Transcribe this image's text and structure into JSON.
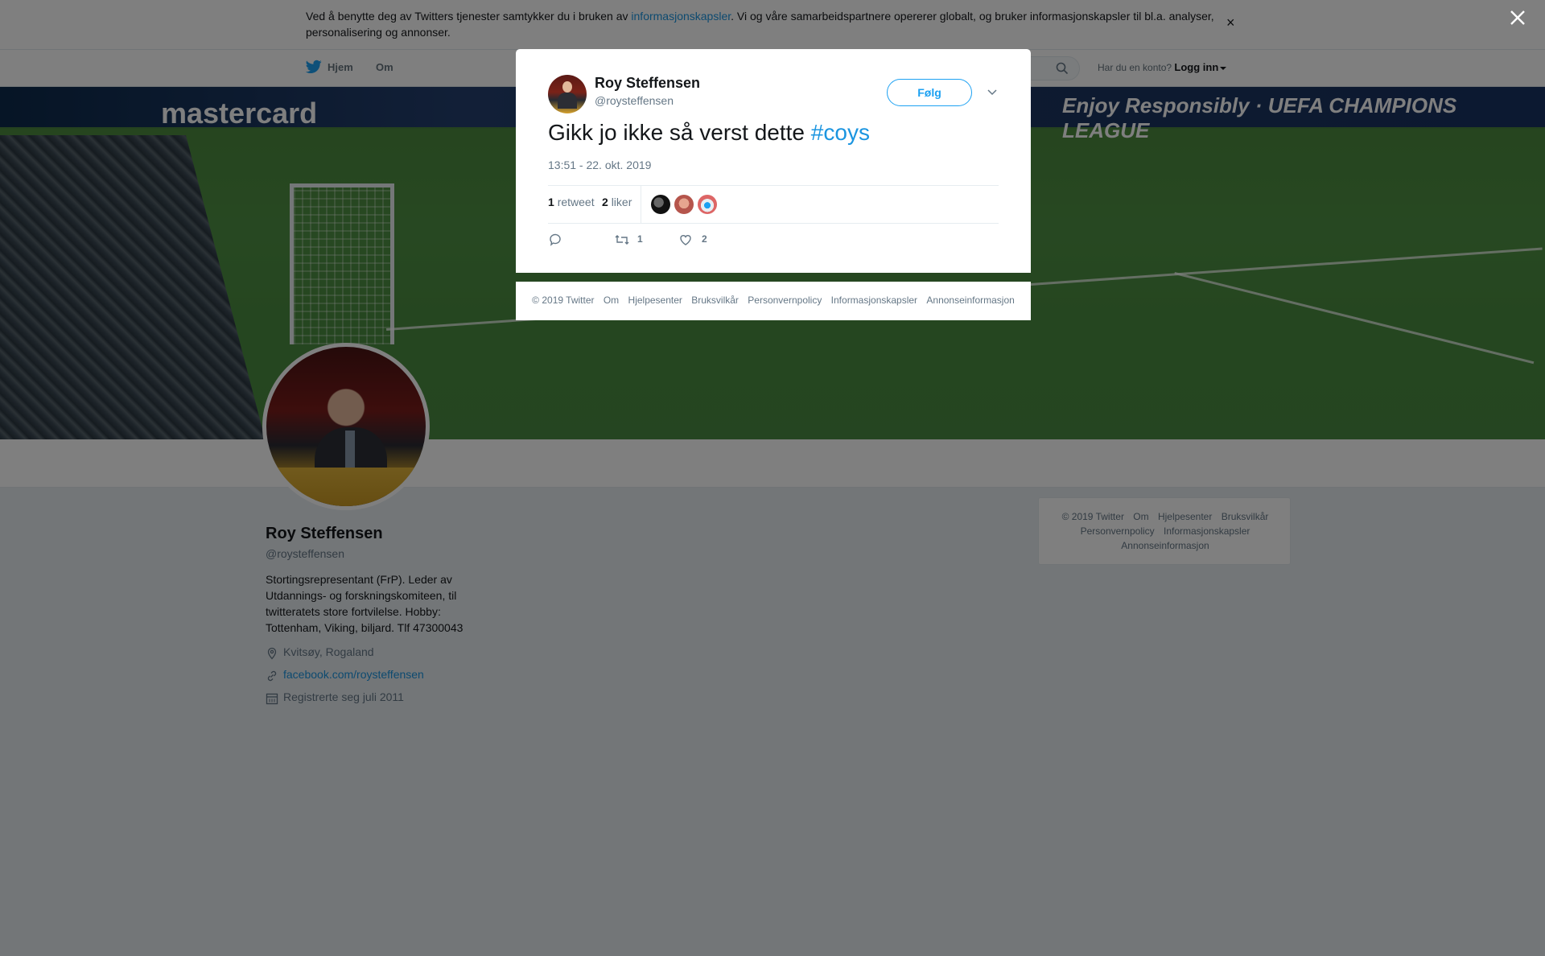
{
  "cookie_banner": {
    "text_before": "Ved å benytte deg av Twitters tjenester samtykker du i bruken av ",
    "link": "informasjonskapsler",
    "text_after": ". Vi og våre samarbeidspartnere opererer globalt, og bruker informasjonskapsler til bl.a. analyser, personalisering og annonser.",
    "close": "×"
  },
  "nav": {
    "home": "Hjem",
    "about": "Om",
    "account_prompt": "Har du en konto?",
    "login": "Logg inn"
  },
  "banner_text": {
    "left": "mastercard",
    "right": "Enjoy Responsibly · UEFA CHAMPIONS LEAGUE"
  },
  "profile": {
    "name": "Roy Steffensen",
    "handle": "@roysteffensen",
    "bio": "Stortingsrepresentant (FrP). Leder av Utdannings- og forskningskomiteen, til twitteratets store fortvilelse. Hobby: Tottenham, Viking, biljard. Tlf 47300043",
    "location": "Kvitsøy, Rogaland",
    "website": "facebook.com/roysteffensen",
    "joined": "Registrerte seg juli 2011"
  },
  "side_footer": [
    "© 2019 Twitter",
    "Om",
    "Hjelpesenter",
    "Bruksvilkår",
    "Personvernpolicy",
    "Informasjonskapsler",
    "Annonseinformasjon"
  ],
  "tweet": {
    "author_name": "Roy Steffensen",
    "author_handle": "@roysteffensen",
    "follow_label": "Følg",
    "text": "Gikk jo ikke så verst dette ",
    "hashtag": "#coys",
    "timestamp": "13:51 - 22. okt. 2019",
    "retweet_count": "1",
    "retweet_label": "retweet",
    "like_count": "2",
    "like_label": "liker",
    "action_retweets": "1",
    "action_likes": "2"
  },
  "modal_footer": [
    "© 2019 Twitter",
    "Om",
    "Hjelpesenter",
    "Bruksvilkår",
    "Personvernpolicy",
    "Informasjonskapsler",
    "Annonseinformasjon"
  ],
  "colors": {
    "accent": "#1da1f2",
    "link": "#1b95e0",
    "muted": "#657786"
  }
}
